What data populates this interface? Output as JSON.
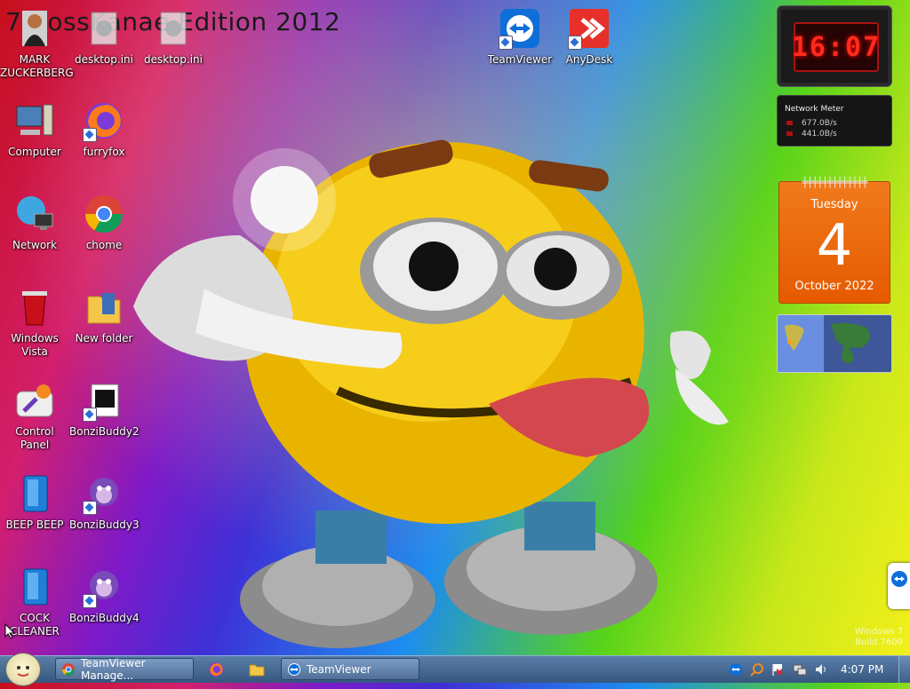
{
  "wallpaper": {
    "title": "7 BossKanae Edition 2012",
    "watermark_line1": "Windows 7",
    "watermark_line2": "Build 7600"
  },
  "desktop_icons": [
    {
      "label": "MARK ZUCKERBERG",
      "icon": "person-icon"
    },
    {
      "label": "desktop.ini",
      "icon": "settings-file-icon"
    },
    {
      "label": "desktop.ini",
      "icon": "settings-file-icon"
    },
    {
      "label": "TeamViewer",
      "icon": "teamviewer-icon"
    },
    {
      "label": "AnyDesk",
      "icon": "anydesk-icon"
    },
    {
      "label": "Computer",
      "icon": "computer-icon"
    },
    {
      "label": "furryfox",
      "icon": "firefox-icon"
    },
    {
      "label": "Network",
      "icon": "network-icon"
    },
    {
      "label": "chome",
      "icon": "chrome-icon"
    },
    {
      "label": "Windows Vista",
      "icon": "recycle-bin-icon"
    },
    {
      "label": "New folder",
      "icon": "folder-icon"
    },
    {
      "label": "Control Panel",
      "icon": "control-panel-icon"
    },
    {
      "label": "BonziBuddy2",
      "icon": "media-file-icon"
    },
    {
      "label": "BEEP BEEP",
      "icon": "blue-app-icon"
    },
    {
      "label": "BonziBuddy3",
      "icon": "bonzi-icon"
    },
    {
      "label": "COCK CLEANER",
      "icon": "blue-app-icon"
    },
    {
      "label": "BonziBuddy4",
      "icon": "bonzi-icon"
    }
  ],
  "gadgets": {
    "clock": {
      "time": "16:07"
    },
    "network_meter": {
      "title": "Network Meter",
      "upload": "677.0B/s",
      "download": "441.0B/s"
    },
    "calendar": {
      "weekday": "Tuesday",
      "day": "4",
      "month_year": "October 2022"
    }
  },
  "taskbar": {
    "buttons": [
      {
        "label": "TeamViewer Manage...",
        "icon": "chrome-icon"
      },
      {
        "label": "TeamViewer",
        "icon": "teamviewer-icon"
      }
    ],
    "quick_launch": [
      "firefox-icon",
      "folder-icon"
    ],
    "tray_icons": [
      "teamviewer-icon",
      "search-icon",
      "flag-icon",
      "network-icon",
      "volume-icon"
    ],
    "clock": "4:07 PM"
  },
  "colors": {
    "taskbar": "#4a6b94",
    "clock_red": "#ff2b1c",
    "calendar_orange": "#f07a1c"
  }
}
